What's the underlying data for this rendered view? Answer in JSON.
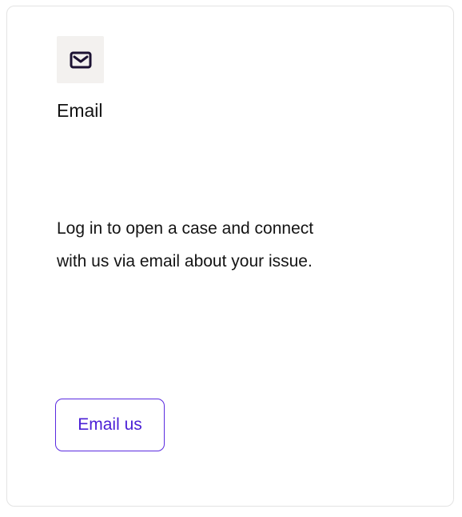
{
  "card": {
    "icon": "envelope-icon",
    "title": "Email",
    "description_line1": "Log in to open a case and connect",
    "description_line2": "with us via email about your issue.",
    "button_label": "Email us"
  },
  "colors": {
    "icon_tile_bg": "#f3f1ef",
    "icon_stroke": "#1c1233",
    "button_border": "#5a2ae0",
    "button_text": "#4a1fd6",
    "text": "#141414"
  }
}
